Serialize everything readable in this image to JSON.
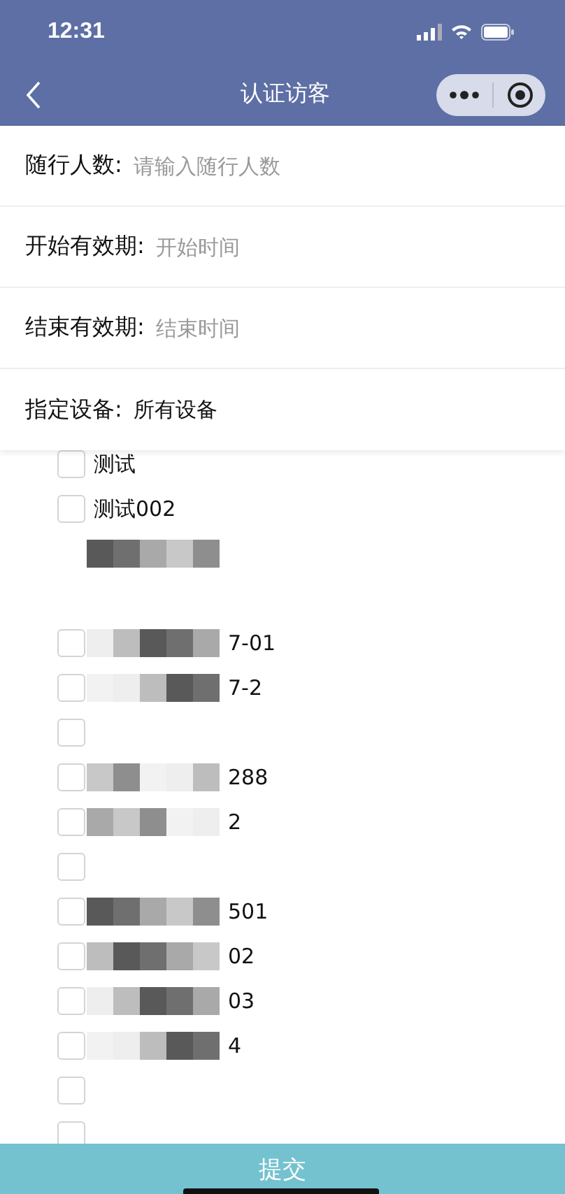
{
  "status_bar": {
    "time": "12:31"
  },
  "nav": {
    "title": "认证访客"
  },
  "form": [
    {
      "label": "随行人数:",
      "placeholder": "请输入随行人数"
    },
    {
      "label": "开始有效期:",
      "placeholder": "开始时间"
    },
    {
      "label": "结束有效期:",
      "placeholder": "结束时间"
    },
    {
      "label": "指定设备:",
      "value": "所有设备"
    }
  ],
  "devices": [
    {
      "kind": "checkbox",
      "checked": false,
      "masked": false,
      "label": "测试"
    },
    {
      "kind": "checkbox",
      "checked": false,
      "masked": false,
      "label": "测试002"
    },
    {
      "kind": "covered",
      "masked": true
    },
    {
      "kind": "covered",
      "masked": false
    },
    {
      "kind": "checkbox",
      "checked": false,
      "masked": true,
      "label": "7-01"
    },
    {
      "kind": "checkbox",
      "checked": false,
      "masked": true,
      "label": "7-2"
    },
    {
      "kind": "checkbox",
      "checked": false,
      "masked": false
    },
    {
      "kind": "checkbox",
      "checked": false,
      "masked": true,
      "label": "288"
    },
    {
      "kind": "checkbox",
      "checked": false,
      "masked": true,
      "label": "2"
    },
    {
      "kind": "checkbox",
      "checked": false,
      "masked": false
    },
    {
      "kind": "checkbox",
      "checked": false,
      "masked": true,
      "label": "501"
    },
    {
      "kind": "checkbox",
      "checked": false,
      "masked": true,
      "label": "02"
    },
    {
      "kind": "checkbox",
      "checked": false,
      "masked": true,
      "label": "03"
    },
    {
      "kind": "checkbox",
      "checked": false,
      "masked": true,
      "label": "4"
    },
    {
      "kind": "checkbox",
      "checked": false,
      "masked": false
    },
    {
      "kind": "checkbox",
      "checked": false,
      "masked": false
    }
  ],
  "submit": {
    "label": "提交"
  }
}
